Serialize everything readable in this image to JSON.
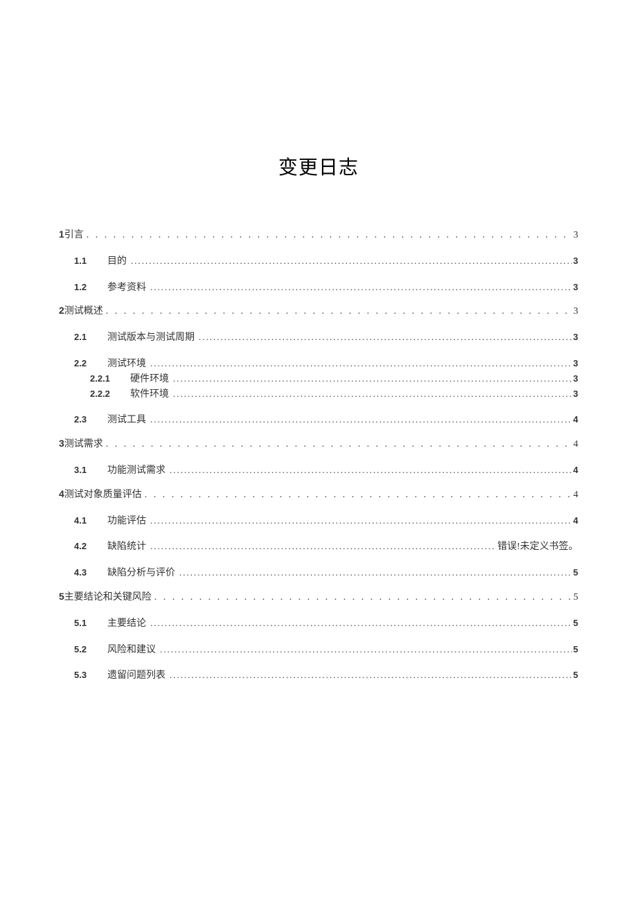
{
  "title": "变更日志",
  "toc": [
    {
      "level": 1,
      "num": "1",
      "label": "引言",
      "page": "3"
    },
    {
      "level": 2,
      "num": "1.1",
      "label": "目的",
      "page": "3"
    },
    {
      "level": 2,
      "num": "1.2",
      "label": "参考资料",
      "page": "3"
    },
    {
      "level": 1,
      "num": "2",
      "label": "测试概述",
      "page": "3"
    },
    {
      "level": 2,
      "num": "2.1",
      "label": "测试版本与测试周期",
      "page": "3"
    },
    {
      "level": 2,
      "num": "2.2",
      "label": "测试环境",
      "page": "3"
    },
    {
      "level": 3,
      "num": "2.2.1",
      "label": "硬件环境",
      "page": "3"
    },
    {
      "level": 3,
      "num": "2.2.2",
      "label": "软件环境",
      "page": "3"
    },
    {
      "level": 2,
      "num": "2.3",
      "label": "测试工具",
      "page": "4"
    },
    {
      "level": 1,
      "num": "3",
      "label": "测试需求",
      "page": "4"
    },
    {
      "level": 2,
      "num": "3.1",
      "label": "功能测试需求",
      "page": "4"
    },
    {
      "level": 1,
      "num": "4",
      "label": "测试对象质量评估",
      "page": "4"
    },
    {
      "level": 2,
      "num": "4.1",
      "label": "功能评估",
      "page": "4"
    },
    {
      "level": 2,
      "num": "4.2",
      "label": "缺陷统计",
      "page": "错误!未定义书签。"
    },
    {
      "level": 2,
      "num": "4.3",
      "label": "缺陷分析与评价",
      "page": "5"
    },
    {
      "level": 1,
      "num": "5",
      "label": "主要结论和关键风险",
      "page": "5"
    },
    {
      "level": 2,
      "num": "5.1",
      "label": "主要结论",
      "page": "5"
    },
    {
      "level": 2,
      "num": "5.2",
      "label": "风险和建议",
      "page": "5"
    },
    {
      "level": 2,
      "num": "5.3",
      "label": "遗留问题列表",
      "page": "5"
    }
  ]
}
